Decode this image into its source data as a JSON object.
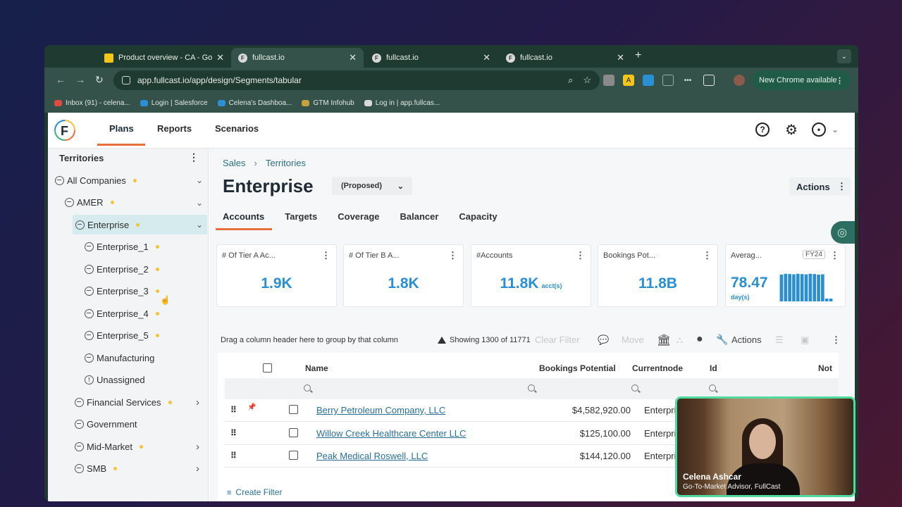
{
  "browser": {
    "tabs": [
      {
        "title": "Product overview - CA - Goo",
        "favicon": "slides-icon"
      },
      {
        "title": "fullcast.io",
        "favicon": "F"
      },
      {
        "title": "fullcast.io",
        "favicon": "F"
      },
      {
        "title": "fullcast.io",
        "favicon": "F"
      }
    ],
    "url": "app.fullcast.io/app/design/Segments/tabular",
    "chrome_available": "New Chrome available",
    "bookmarks": [
      {
        "label": "Inbox (91) - celena...",
        "color": "#e04a3f"
      },
      {
        "label": "Login | Salesforce",
        "color": "#2a8fd4"
      },
      {
        "label": "Celena's Dashboa...",
        "color": "#2a8fd4"
      },
      {
        "label": "GTM Infohub",
        "color": "#c7a040"
      },
      {
        "label": "Log in | app.fullcas...",
        "color": "#d9d9d9"
      }
    ]
  },
  "header": {
    "nav": [
      "Plans",
      "Reports",
      "Scenarios"
    ],
    "active_nav": "Plans"
  },
  "sidebar": {
    "title": "Territories",
    "items": [
      {
        "label": "All Companies",
        "icon": "globe-icon",
        "dot": true,
        "caret": "down"
      },
      {
        "label": "AMER",
        "icon": "globe-icon",
        "dot": true,
        "caret": "down"
      },
      {
        "label": "Enterprise",
        "icon": "globe-icon",
        "dot": true,
        "caret": "down",
        "selected": true
      },
      {
        "label": "Enterprise_1",
        "icon": "globe-icon",
        "dot": true
      },
      {
        "label": "Enterprise_2",
        "icon": "globe-icon",
        "dot": true
      },
      {
        "label": "Enterprise_3",
        "icon": "globe-icon",
        "dot": true
      },
      {
        "label": "Enterprise_4",
        "icon": "globe-icon",
        "dot": true
      },
      {
        "label": "Enterprise_5",
        "icon": "globe-icon",
        "dot": true
      },
      {
        "label": "Manufacturing",
        "icon": "globe-icon",
        "dot": false
      },
      {
        "label": "Unassigned",
        "icon": "alert-icon",
        "dot": false
      },
      {
        "label": "Financial Services",
        "icon": "globe-icon",
        "dot": true,
        "caret": "right"
      },
      {
        "label": "Government",
        "icon": "globe-icon",
        "dot": false
      },
      {
        "label": "Mid-Market",
        "icon": "globe-icon",
        "dot": true,
        "caret": "right"
      },
      {
        "label": "SMB",
        "icon": "globe-icon",
        "dot": true,
        "caret": "right"
      }
    ]
  },
  "main": {
    "breadcrumb": [
      "Sales",
      "Territories"
    ],
    "title": "Enterprise",
    "status_dropdown": "(Proposed)",
    "actions_label": "Actions",
    "tabs": [
      "Accounts",
      "Targets",
      "Coverage",
      "Balancer",
      "Capacity"
    ],
    "active_tab": "Accounts",
    "cards": [
      {
        "title": "# Of Tier A Ac...",
        "value": "1.9K"
      },
      {
        "title": "# Of Tier B A...",
        "value": "1.8K"
      },
      {
        "title": "#Accounts",
        "value": "11.8K",
        "unit": "acct(s)"
      },
      {
        "title": "Bookings Pot...",
        "value": "11.8B"
      },
      {
        "title": "Averag...",
        "badge": "FY24",
        "value": "78.47",
        "unit": "day(s)",
        "spark": [
          0.95,
          0.98,
          0.97,
          0.96,
          0.98,
          0.97,
          0.96,
          0.98,
          0.97,
          0.95,
          0.96,
          0.1,
          0.1
        ]
      }
    ],
    "grid_toolbar": {
      "drag_hint": "Drag a column header here to group by that column",
      "showing": "Showing 1300 of 11771",
      "clear_filter": "Clear Filter",
      "move": "Move",
      "actions": "Actions"
    },
    "columns": [
      "Name",
      "Bookings Potential",
      "Currentnode",
      "Id",
      "Not"
    ],
    "rows": [
      {
        "name": "Berry Petroleum Company, LLC",
        "bookings": "$4,582,920.00",
        "node": "Enterprise",
        "pinned": true
      },
      {
        "name": "Willow Creek Healthcare Center LLC",
        "bookings": "$125,100.00",
        "node": "Enterprise",
        "pinned": false
      },
      {
        "name": "Peak Medical Roswell, LLC",
        "bookings": "$144,120.00",
        "node": "Enterprise",
        "pinned": false
      }
    ],
    "create_filter": "Create Filter"
  },
  "video": {
    "name": "Celena Ashcar",
    "role": "Go-To-Market Advisor, FullCast"
  }
}
